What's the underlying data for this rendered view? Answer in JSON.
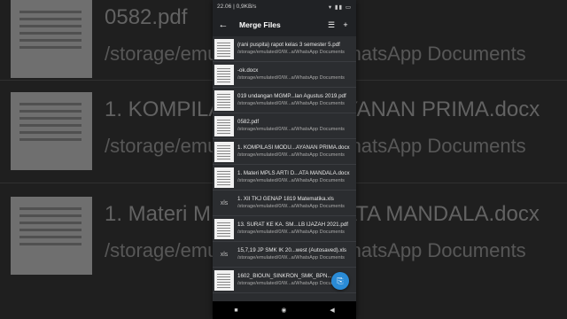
{
  "status": {
    "time": "22.06 | 0,9KB/s",
    "icons": "▾ ▮▮ ▭"
  },
  "toolbar": {
    "title": "Merge Files",
    "back_icon": "←",
    "list_icon": "☰",
    "add_icon": "+"
  },
  "files": [
    {
      "name": "(rani puspita) rapot kelas 3 semester 5.pdf",
      "path": "/storage/emulated/0/W...a/WhatsApp Documents",
      "thumb": "doc"
    },
    {
      "name": "-ok.docx",
      "path": "/storage/emulated/0/W...a/WhatsApp Documents",
      "thumb": "doc"
    },
    {
      "name": "019 undangan MGMP...lan Agustus 2019.pdf",
      "path": "/storage/emulated/0/W...a/WhatsApp Documents",
      "thumb": "doc"
    },
    {
      "name": "0582.pdf",
      "path": "/storage/emulated/0/W...a/WhatsApp Documents",
      "thumb": "doc"
    },
    {
      "name": "1. KOMPILASI MODU...AYANAN PRIMA.docx",
      "path": "/storage/emulated/0/W...a/WhatsApp Documents",
      "thumb": "doc"
    },
    {
      "name": "1. Materi MPLS ARTI D...ATA MANDALA.docx",
      "path": "/storage/emulated/0/W...a/WhatsApp Documents",
      "thumb": "doc"
    },
    {
      "name": "1. XII TKJ GENAP 1819 Matematika.xls",
      "path": "/storage/emulated/0/W...a/WhatsApp Documents",
      "thumb": "xls"
    },
    {
      "name": "13. SURAT KE KA. SM...LB IJAZAH 2021.pdf",
      "path": "/storage/emulated/0/W...a/WhatsApp Documents",
      "thumb": "doc"
    },
    {
      "name": "15,7,19 JP SMK IK 20...west (Autosaved).xls",
      "path": "/storage/emulated/0/W...a/WhatsApp Documents",
      "thumb": "xls"
    },
    {
      "name": "1602_BIOUN_SINKRON_SMK_BPN...",
      "path": "/storage/emulated/0/W...a/WhatsApp Documents",
      "thumb": "doc"
    }
  ],
  "thumb_label_xls": "xls",
  "fab_icon": "⎘",
  "navbar": {
    "recent": "■",
    "home": "◉",
    "back": "◀"
  },
  "background": {
    "rows": [
      {
        "title": "0582.pdf",
        "path": "/storage/emulated/0/W...a/WhatsApp Documents"
      },
      {
        "title": "1. KOMPILASI MODU...AYANAN PRIMA.docx",
        "path": "/storage/emulated/0/W...a/WhatsApp Documents"
      },
      {
        "title": "1. Materi MPLS ARTI D...ATA MANDALA.docx",
        "path": "/storage/emulated/0/W...a/WhatsApp Documents"
      }
    ]
  }
}
